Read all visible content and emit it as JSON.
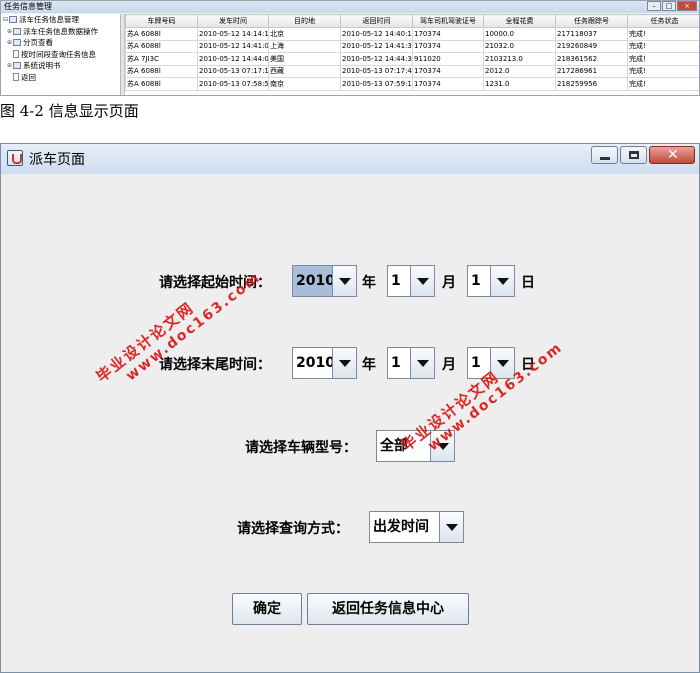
{
  "top_window": {
    "title": "任务信息管理",
    "tree": [
      {
        "label": "派车任务信息管理",
        "kind": "folder",
        "expander": "⊟"
      },
      {
        "label": "派车任务信息数据操作",
        "kind": "folder",
        "expander": "⊕"
      },
      {
        "label": "分页查看",
        "kind": "folder",
        "expander": "⊕"
      },
      {
        "label": "按时间段查询任务信息",
        "kind": "doc",
        "expander": ""
      },
      {
        "label": "系统说明书",
        "kind": "folder",
        "expander": "⊕"
      },
      {
        "label": "返回",
        "kind": "doc",
        "expander": ""
      }
    ],
    "columns": [
      "车牌号码",
      "发车时间",
      "目的地",
      "返回时间",
      "驾车司机驾驶证号",
      "全程花费",
      "任务跟踪号",
      "任务状态"
    ],
    "rows": [
      [
        "苏A 6088l",
        "2010-05-12 14:14:1...",
        "北京",
        "2010-05-12 14:40:1...",
        "170374",
        "10000.0",
        "217118037",
        "完成!"
      ],
      [
        "苏A 6088l",
        "2010-05-12 14:41:0...",
        "上海",
        "2010-05-12 14:41:3...",
        "170374",
        "21032.0",
        "219260849",
        "完成!"
      ],
      [
        "苏A 7JI3C",
        "2010-05-12 14:44:0...",
        "美国",
        "2010-05-12 14:44:3...",
        "911020",
        "2103213.0",
        "218361562",
        "完成!"
      ],
      [
        "苏A 6088l",
        "2010-05-13 07:17:1...",
        "西藏",
        "2010-05-13 07:17:4...",
        "170374",
        "2012.0",
        "217286961",
        "完成!"
      ],
      [
        "苏A 6088l",
        "2010-05-13 07:58:5...",
        "南京",
        "2010-05-13 07:59:1...",
        "170374",
        "1231.0",
        "218259956",
        "完成!"
      ]
    ]
  },
  "caption": "图 4-2 信息显示页面",
  "dialog": {
    "title": "派车页面",
    "start_label": "请选择起始时间：",
    "end_label": "请选择末尾时间：",
    "vehicle_label": "请选择车辆型号：",
    "query_label": "请选择查询方式：",
    "year_unit": "年",
    "month_unit": "月",
    "day_unit": "日",
    "start": {
      "year": "2010",
      "month": "1",
      "day": "1"
    },
    "end": {
      "year": "2010",
      "month": "1",
      "day": "1"
    },
    "vehicle_value": "全部",
    "query_value": "出发时间",
    "ok_button": "确定",
    "back_button": "返回任务信息中心"
  },
  "watermark": {
    "line_a": "毕业设计论文网",
    "line_b": "www.doc163.com",
    "color": "#dd1111"
  }
}
